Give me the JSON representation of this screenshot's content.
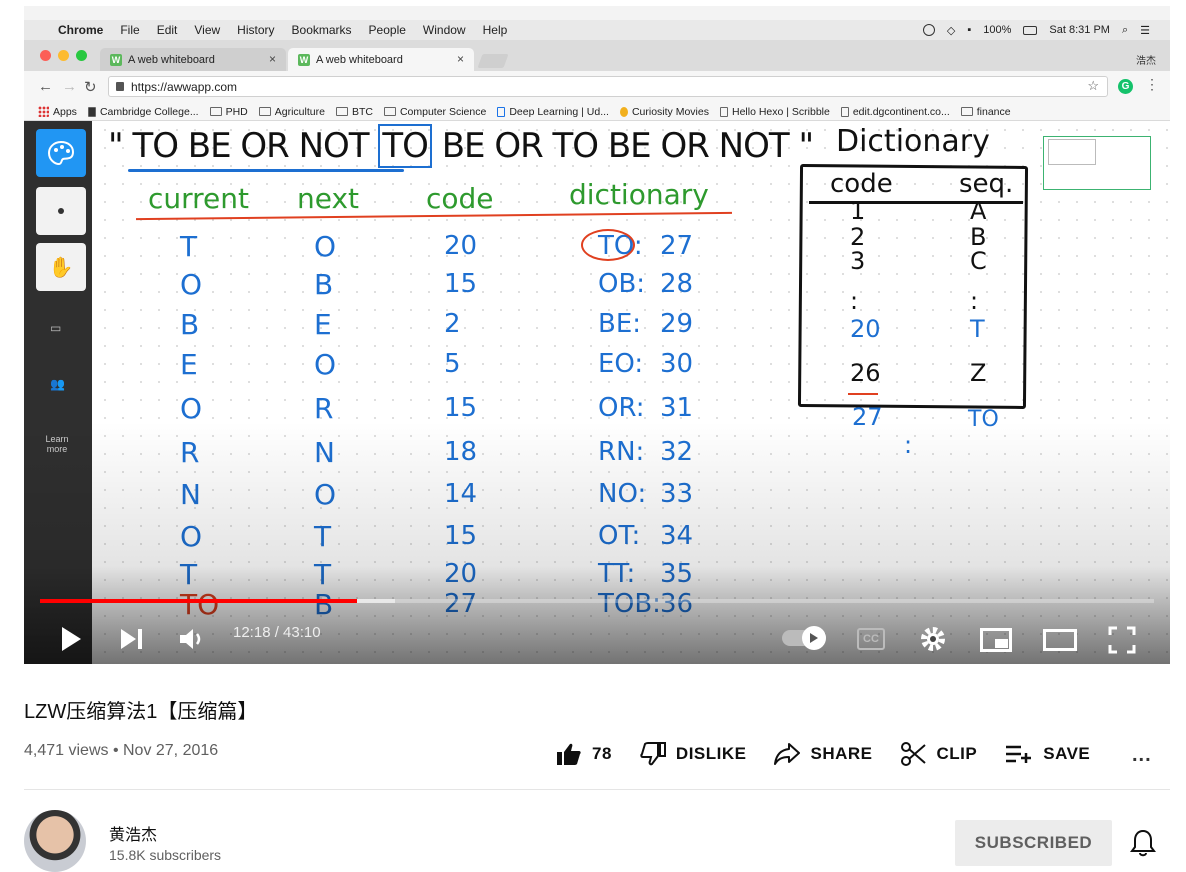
{
  "mac_menubar": {
    "apple": "",
    "items": [
      "Chrome",
      "File",
      "Edit",
      "View",
      "History",
      "Bookmarks",
      "People",
      "Window",
      "Help"
    ],
    "battery": "100%",
    "clock": "Sat 8:31 PM"
  },
  "browser": {
    "tabs": [
      {
        "title": "A web whiteboard",
        "favicon": "W"
      },
      {
        "title": "A web whiteboard",
        "favicon": "W"
      }
    ],
    "profile": "浩杰",
    "url": "https://awwapp.com",
    "bookmarks": [
      "Apps",
      "Cambridge College...",
      "PHD",
      "Agriculture",
      "BTC",
      "Computer Science",
      "Deep Learning | Ud...",
      "Curiosity Movies",
      "Hello Hexo | Scribble",
      "edit.dgcontinent.co...",
      "finance"
    ]
  },
  "whiteboard": {
    "toolbar": {
      "learn_more": "Learn more"
    },
    "header_quote": "\" TO BE OR NOT TO BE OR TO BE OR NOT \"",
    "header_parts": [
      "\" TO BE OR NOT ",
      "TO",
      " BE OR TO BE OR NOT \""
    ],
    "columns": {
      "current": "current",
      "next": "next",
      "code": "code",
      "dictionary": "dictionary"
    },
    "rows": [
      {
        "current": "T",
        "next": "O",
        "code": "20",
        "entry": "TO:",
        "num": "27"
      },
      {
        "current": "O",
        "next": "B",
        "code": "15",
        "entry": "OB:",
        "num": "28"
      },
      {
        "current": "B",
        "next": "E",
        "code": "2",
        "entry": "BE:",
        "num": "29"
      },
      {
        "current": "E",
        "next": "O",
        "code": "5",
        "entry": "EO:",
        "num": "30"
      },
      {
        "current": "O",
        "next": "R",
        "code": "15",
        "entry": "OR:",
        "num": "31"
      },
      {
        "current": "R",
        "next": "N",
        "code": "18",
        "entry": "RN:",
        "num": "32"
      },
      {
        "current": "N",
        "next": "O",
        "code": "14",
        "entry": "NO:",
        "num": "33"
      },
      {
        "current": "O",
        "next": "T",
        "code": "15",
        "entry": "OT:",
        "num": "34"
      },
      {
        "current": "T",
        "next": "T",
        "code": "20",
        "entry": "TT:",
        "num": "35"
      },
      {
        "current": "TO",
        "next": "B",
        "code": "27",
        "entry": "TOB:",
        "num": "36"
      }
    ],
    "dictionary": {
      "title": "Dictionary",
      "col_code": "code",
      "col_seq": "seq.",
      "rows": [
        {
          "code": "1",
          "seq": "A"
        },
        {
          "code": "2",
          "seq": "B"
        },
        {
          "code": "3",
          "seq": "C"
        },
        {
          "code": ":",
          "seq": ":"
        },
        {
          "code": "20",
          "seq": "T"
        },
        {
          "code": "26",
          "seq": "Z"
        }
      ],
      "extra": {
        "code": "27",
        "seq": "TO",
        "dots": ":"
      }
    }
  },
  "player": {
    "current_time": "12:18",
    "duration": "43:10",
    "time_display": "12:18 / 43:10",
    "played_fraction": 0.285,
    "buffered_fraction": 0.319,
    "cc_label": "CC"
  },
  "video": {
    "title": "LZW压缩算法1【压缩篇】",
    "views_date": "4,471 views • Nov 27, 2016",
    "likes": "78",
    "dislike_label": "DISLIKE",
    "share_label": "SHARE",
    "clip_label": "CLIP",
    "save_label": "SAVE",
    "more": "..."
  },
  "channel": {
    "name": "黄浩杰",
    "subscribers": "15.8K subscribers",
    "subscribe_label": "SUBSCRIBED"
  },
  "colors": {
    "progress_red": "#ff0000",
    "ink_green": "#2e9a2e",
    "ink_blue": "#1d6fd1",
    "ink_red": "#e04020",
    "toolbar_bg": "#2f2f2f",
    "active_tool": "#2196f3"
  }
}
